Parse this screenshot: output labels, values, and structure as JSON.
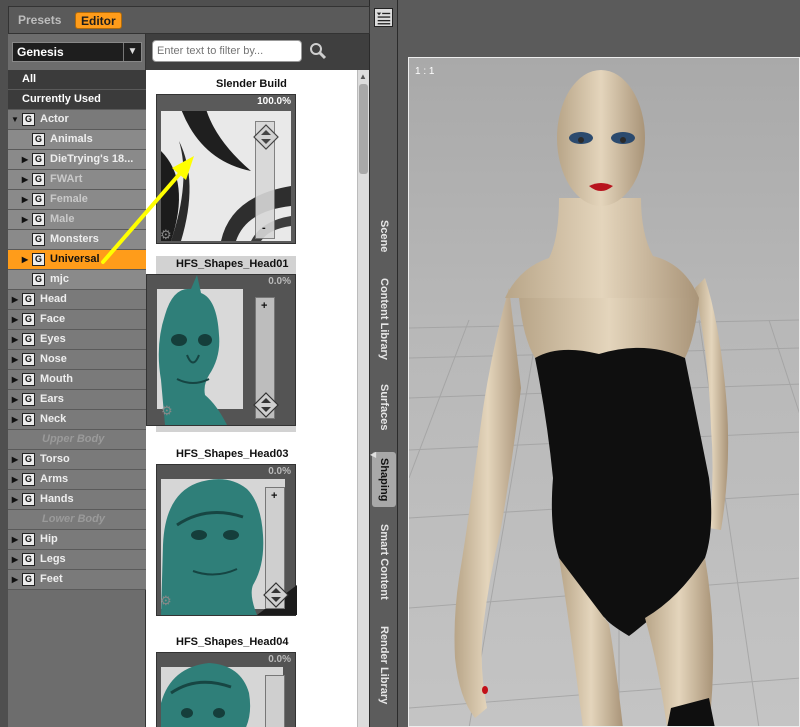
{
  "tabs": {
    "presets": "Presets",
    "editor": "Editor"
  },
  "figure_select": {
    "value": "Genesis"
  },
  "categories": [
    {
      "label": "All",
      "kind": "dark"
    },
    {
      "label": "Currently Used",
      "kind": "dark"
    },
    {
      "label": "Actor",
      "kind": "group",
      "expanded": true
    },
    {
      "label": "Animals",
      "kind": "sub"
    },
    {
      "label": "DieTrying's 18...",
      "kind": "sub-group"
    },
    {
      "label": "FWArt",
      "kind": "sub-group",
      "grey": true
    },
    {
      "label": "Female",
      "kind": "sub-group",
      "grey": true
    },
    {
      "label": "Male",
      "kind": "sub-group",
      "grey": true
    },
    {
      "label": "Monsters",
      "kind": "sub"
    },
    {
      "label": "Universal",
      "kind": "sub-group",
      "selected": true
    },
    {
      "label": "mjc",
      "kind": "sub"
    },
    {
      "label": "Head",
      "kind": "group"
    },
    {
      "label": "Face",
      "kind": "group"
    },
    {
      "label": "Eyes",
      "kind": "group"
    },
    {
      "label": "Nose",
      "kind": "group"
    },
    {
      "label": "Mouth",
      "kind": "group"
    },
    {
      "label": "Ears",
      "kind": "group"
    },
    {
      "label": "Neck",
      "kind": "group"
    },
    {
      "label": "Upper Body",
      "kind": "dim"
    },
    {
      "label": "Torso",
      "kind": "group"
    },
    {
      "label": "Arms",
      "kind": "group"
    },
    {
      "label": "Hands",
      "kind": "group"
    },
    {
      "label": "Lower Body",
      "kind": "dim"
    },
    {
      "label": "Hip",
      "kind": "group"
    },
    {
      "label": "Legs",
      "kind": "group"
    },
    {
      "label": "Feet",
      "kind": "group"
    }
  ],
  "filter": {
    "placeholder": "Enter text to filter by..."
  },
  "morphs": [
    {
      "title": "Slender Build",
      "value": "100.0%",
      "level": 1.0
    },
    {
      "title": "HFS_Shapes_Head01",
      "value": "0.0%",
      "level": 0.0
    },
    {
      "title": "HFS_Shapes_Head03",
      "value": "0.0%",
      "level": 0.0
    },
    {
      "title": "HFS_Shapes_Head04",
      "value": "0.0%",
      "level": 0.0
    }
  ],
  "side_tabs": [
    {
      "label": "Scene",
      "active": false
    },
    {
      "label": "Content Library",
      "active": false
    },
    {
      "label": "Surfaces",
      "active": false
    },
    {
      "label": "Shaping",
      "active": true
    },
    {
      "label": "Smart Content",
      "active": false
    },
    {
      "label": "Render Library",
      "active": false
    }
  ],
  "viewport": {
    "label": "1 : 1"
  },
  "colors": {
    "accent": "#ff9c1a",
    "annotation_arrow": "#ffff00",
    "alien_skin": "#2f7f79"
  }
}
